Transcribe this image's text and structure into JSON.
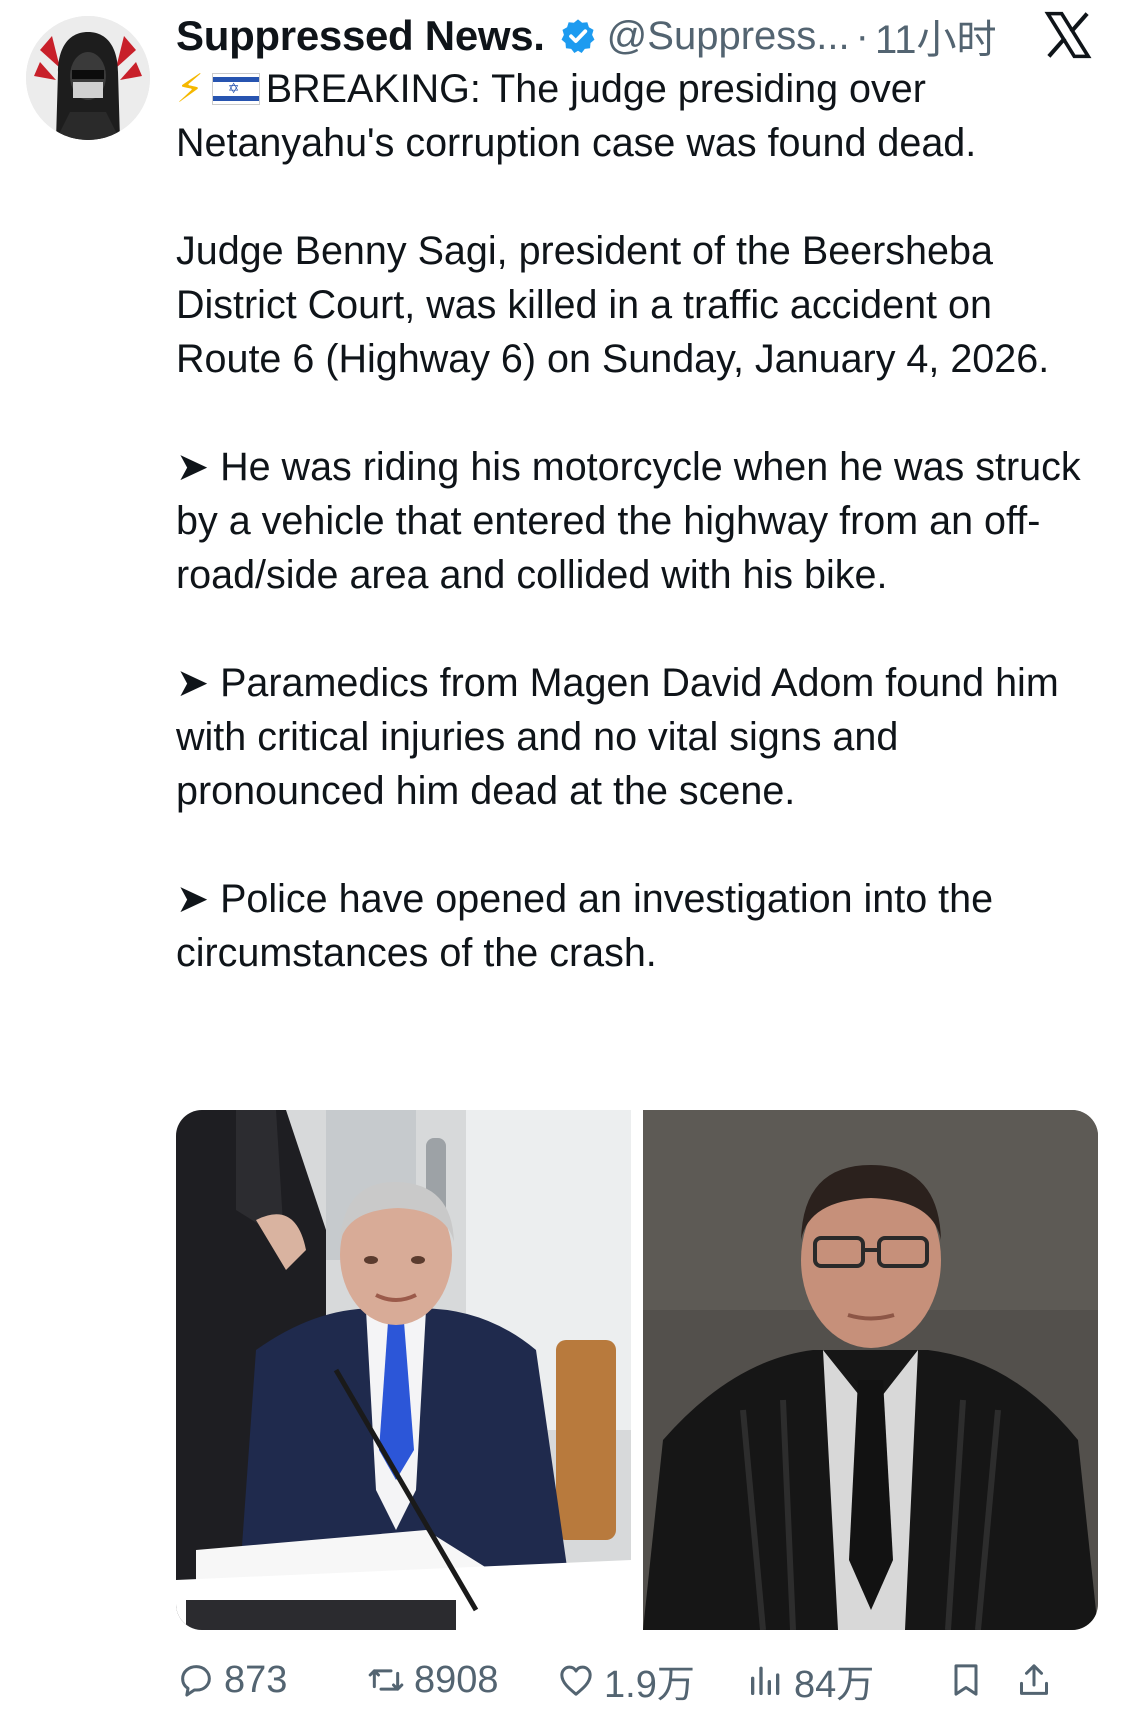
{
  "author": {
    "name": "Suppressed News.",
    "handle": "@Suppress...",
    "time": "11小时"
  },
  "tweet": {
    "bolt": "⚡",
    "headline": "BREAKING: The judge presiding over Netanyahu's corruption case was found dead.",
    "paragraphs": [
      "Judge Benny Sagi, president of the Beersheba District Court, was killed in a traffic accident on Route 6 (Highway 6) on Sunday, January 4, 2026.",
      "➤ He was riding his motorcycle when he was struck by a vehicle that entered the highway from an off-road/side area and collided with his bike.",
      "➤ Paramedics from Magen David Adom found him with critical injuries and no vital signs and pronounced him dead at the scene.",
      "➤ Police have opened an investigation into the circumstances of the crash."
    ]
  },
  "metrics": {
    "replies": "873",
    "retweets": "8908",
    "likes": "1.9万",
    "views": "84万"
  },
  "icons": {
    "verified": "verified-badge-icon",
    "x_logo": "x-logo-icon",
    "flag": "israel-flag-icon",
    "reply": "reply-icon",
    "retweet": "retweet-icon",
    "like": "heart-icon",
    "views": "views-icon",
    "bookmark": "bookmark-icon",
    "share": "share-icon"
  },
  "colors": {
    "text": "#0f1419",
    "secondary": "#536471",
    "verified": "#1d9bf0",
    "bolt": "#f5b800"
  }
}
